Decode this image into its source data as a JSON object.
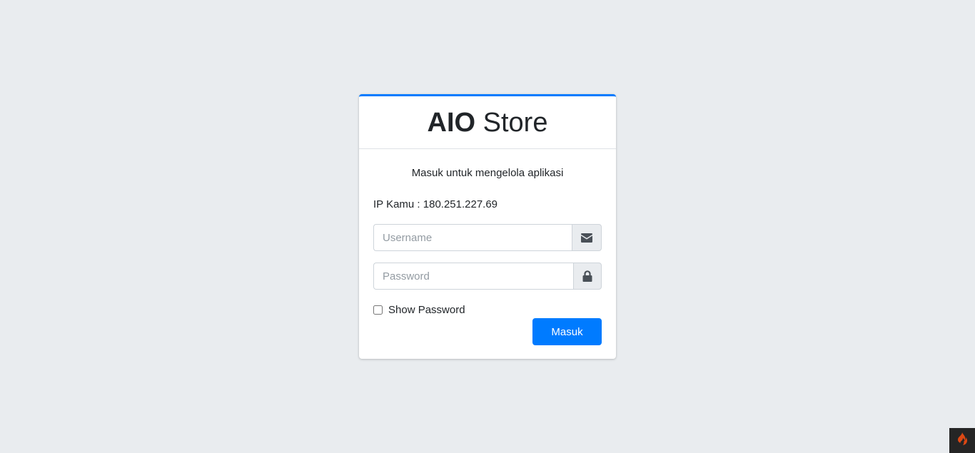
{
  "brand": {
    "bold": "AIO",
    "light": "Store"
  },
  "login": {
    "message": "Masuk untuk mengelola aplikasi",
    "ip_text": "IP Kamu : 180.251.227.69",
    "username_placeholder": "Username",
    "password_placeholder": "Password",
    "show_password_label": "Show Password",
    "submit_label": "Masuk"
  },
  "icons": {
    "username": "envelope-icon",
    "password": "lock-icon",
    "toolbar": "flame-icon"
  },
  "colors": {
    "accent": "#007bff",
    "background": "#e9ecef",
    "toolbar_bg": "#252525",
    "toolbar_icon": "#dd4814"
  }
}
